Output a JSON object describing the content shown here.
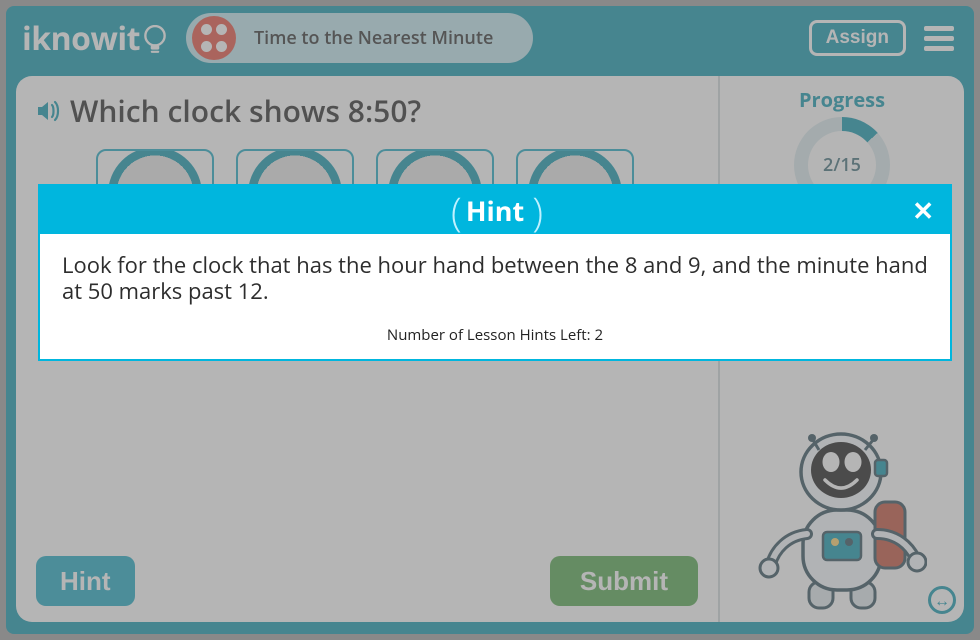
{
  "header": {
    "logo_text": "iknowit",
    "lesson_title": "Time to the Nearest Minute",
    "assign_label": "Assign"
  },
  "question": {
    "text": "Which clock shows 8:50?",
    "hint_button_label": "Hint",
    "submit_button_label": "Submit"
  },
  "sidebar": {
    "progress_label": "Progress",
    "progress_value": "2/15"
  },
  "hint_modal": {
    "title": "Hint",
    "body": "Look for the clock that has the hour hand between the 8 and 9, and the minute hand at 50 marks past 12.",
    "remaining_label": "Number of Lesson Hints Left: 2"
  }
}
